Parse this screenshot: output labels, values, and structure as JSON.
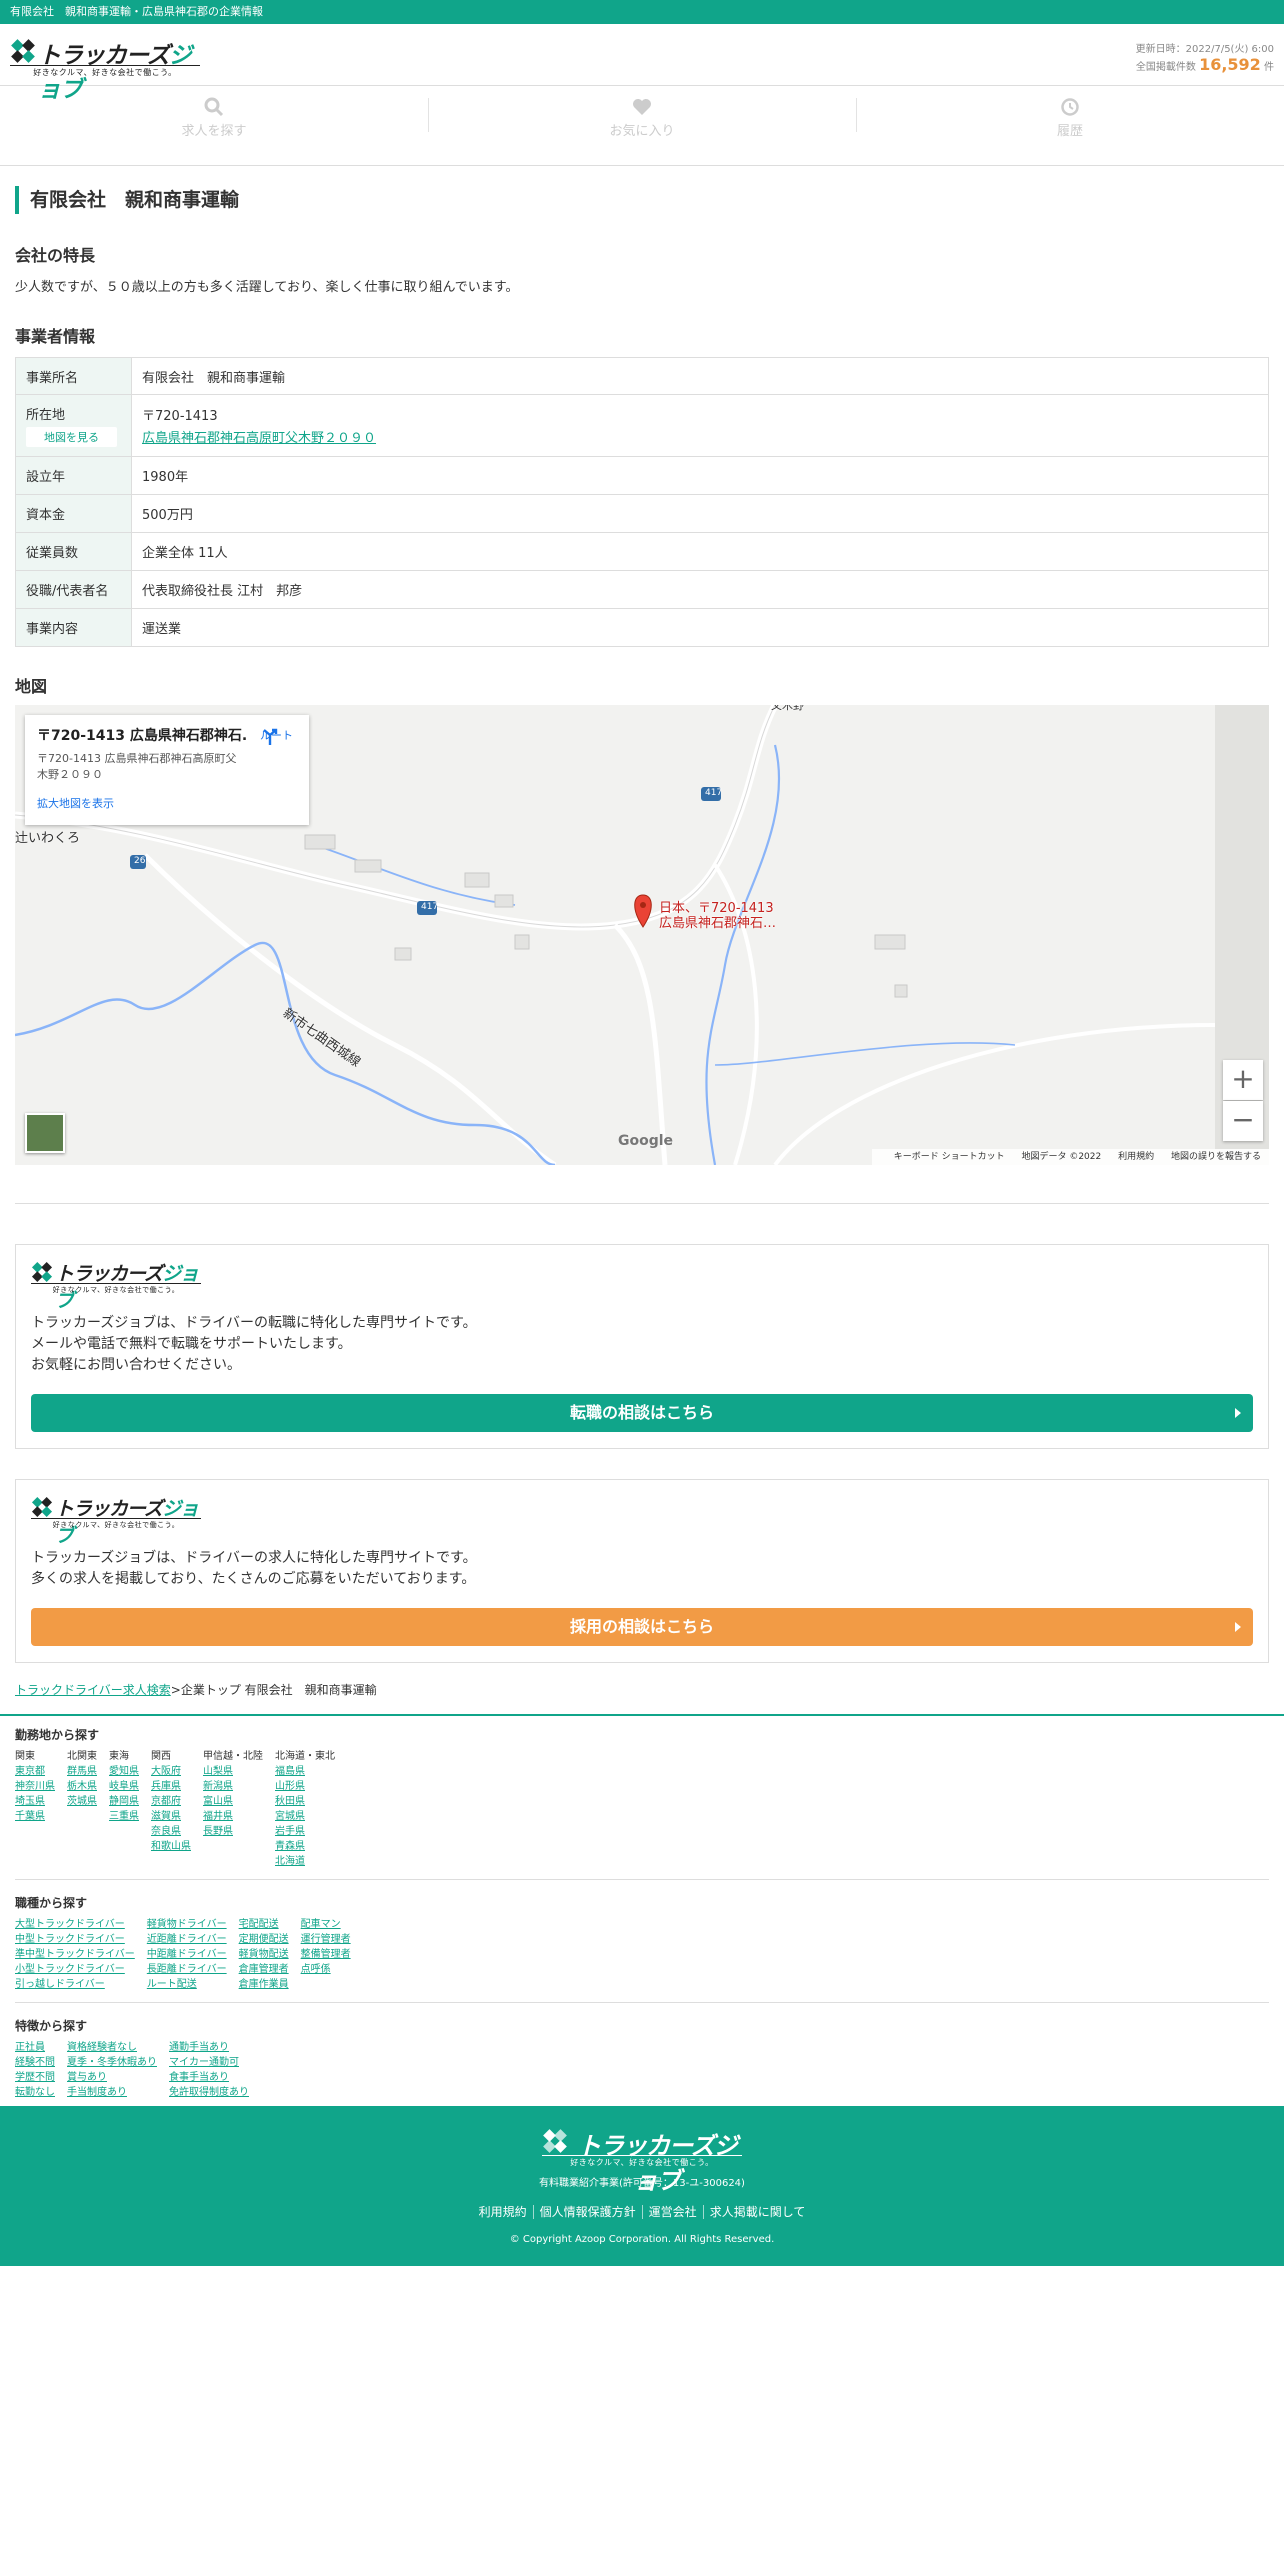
{
  "topbar": {
    "text": "有限会社　親和商事運輸・広島県神石郡の企業情報"
  },
  "header": {
    "logo_text_1": "トラッカーズ",
    "logo_text_2": "ジョブ",
    "logo_tagline": "好きなクルマ、好きな会社で働こう。",
    "updated": "更新日時：2022/7/5(火) 6:00",
    "count_label": "全国掲載件数",
    "count_value": "16,592",
    "count_unit": "件"
  },
  "nav": {
    "search": "求人を探す",
    "favorites": "お気に入り",
    "history": "履歴"
  },
  "page_title": "有限会社　親和商事運輸",
  "features": {
    "heading": "会社の特長",
    "text": "少人数ですが、５０歳以上の方も多く活躍しており、楽しく仕事に取り組んでいます。"
  },
  "info": {
    "heading": "事業者情報",
    "rows": [
      {
        "label": "事業所名",
        "value": "有限会社　親和商事運輸"
      },
      {
        "label": "所在地",
        "postal": "〒720-1413",
        "address": "広島県神石郡神石高原町父木野２０９０",
        "map_button": "地図を見る"
      },
      {
        "label": "設立年",
        "value": "1980年"
      },
      {
        "label": "資本金",
        "value": "500万円"
      },
      {
        "label": "従業員数",
        "value": "企業全体 11人"
      },
      {
        "label": "役職/代表者名",
        "value": "代表取締役社長 江村　邦彦"
      },
      {
        "label": "事業内容",
        "value": "運送業"
      }
    ]
  },
  "map": {
    "heading": "地図",
    "card_title": "〒720-1413 広島県神石郡神石...",
    "card_address": "〒720-1413 広島県神石郡神石高原町父木野２０９０",
    "card_link": "拡大地図を表示",
    "route": "ルート",
    "marker_line1": "日本、〒720-1413",
    "marker_line2": "広島県神石郡神石…",
    "place_label": "辻いわくろ",
    "road_label": "新市七曲西城線",
    "top_label": "父木野",
    "route_417": "417",
    "route_26": "26",
    "zoom_in": "+",
    "zoom_out": "−",
    "google": "Google",
    "footer": [
      "キーボード ショートカット",
      "地図データ ©2022",
      "利用規約",
      "地図の誤りを報告する"
    ]
  },
  "promo1": {
    "text_lines": [
      "トラッカーズジョブは、ドライバーの転職に特化した専門サイトです。",
      "メールや電話で無料で転職をサポートいたします。",
      "お気軽にお問い合わせください。"
    ],
    "button": "転職の相談はこちら"
  },
  "promo2": {
    "text_lines": [
      "トラッカーズジョブは、ドライバーの求人に特化した専門サイトです。",
      "多くの求人を掲載しており、たくさんのご応募をいただいております。"
    ],
    "button": "採用の相談はこちら"
  },
  "breadcrumb": {
    "link": "トラックドライバー求人検索",
    "rest": ">企業トップ 有限会社　親和商事運輸"
  },
  "footer_links": {
    "area": {
      "heading": "勤務地から探す",
      "cols": [
        {
          "head": "関東",
          "items": [
            "東京都",
            "神奈川県",
            "埼玉県",
            "千葉県"
          ]
        },
        {
          "head": "北関東",
          "items": [
            "群馬県",
            "栃木県",
            "茨城県"
          ]
        },
        {
          "head": "東海",
          "items": [
            "愛知県",
            "岐阜県",
            "静岡県",
            "三重県"
          ]
        },
        {
          "head": "関西",
          "items": [
            "大阪府",
            "兵庫県",
            "京都府",
            "滋賀県",
            "奈良県",
            "和歌山県"
          ]
        },
        {
          "head": "甲信越・北陸",
          "items": [
            "山梨県",
            "新潟県",
            "富山県",
            "福井県",
            "長野県"
          ]
        },
        {
          "head": "北海道・東北",
          "items": [
            "福島県",
            "山形県",
            "秋田県",
            "宮城県",
            "岩手県",
            "青森県",
            "北海道"
          ]
        }
      ]
    },
    "job": {
      "heading": "職種から探す",
      "cols": [
        {
          "items": [
            "大型トラックドライバー",
            "中型トラックドライバー",
            "準中型トラックドライバー",
            "小型トラックドライバー",
            "引っ越しドライバー"
          ]
        },
        {
          "items": [
            "軽貨物ドライバー",
            "近距離ドライバー",
            "中距離ドライバー",
            "長距離ドライバー",
            "ルート配送"
          ]
        },
        {
          "items": [
            "宅配配送",
            "定期便配送",
            "軽貨物配送",
            "倉庫管理者",
            "倉庫作業員"
          ]
        },
        {
          "items": [
            "配車マン",
            "運行管理者",
            "整備管理者",
            "点呼係"
          ]
        }
      ]
    },
    "feature": {
      "heading": "特徴から探す",
      "cols": [
        {
          "items": [
            "正社員",
            "経験不問",
            "学歴不問",
            "転勤なし"
          ]
        },
        {
          "items": [
            "資格経験者なし",
            "夏季・冬季休暇あり",
            "賞与あり",
            "手当制度あり"
          ]
        },
        {
          "items": [
            "通勤手当あり",
            "マイカー通勤可",
            "食事手当あり",
            "免許取得制度あり"
          ]
        }
      ]
    }
  },
  "site_footer": {
    "license": "有料職業紹介事業(許可番号：13-ユ-300624)",
    "links": [
      "利用規約",
      "個人情報保護方針",
      "運営会社",
      "求人掲載に関して"
    ],
    "copyright": "© Copyright Azoop Corporation. All Rights Reserved."
  },
  "colors": {
    "brand": "#10a58a",
    "accent": "#f29b45",
    "count": "#e8913b"
  }
}
